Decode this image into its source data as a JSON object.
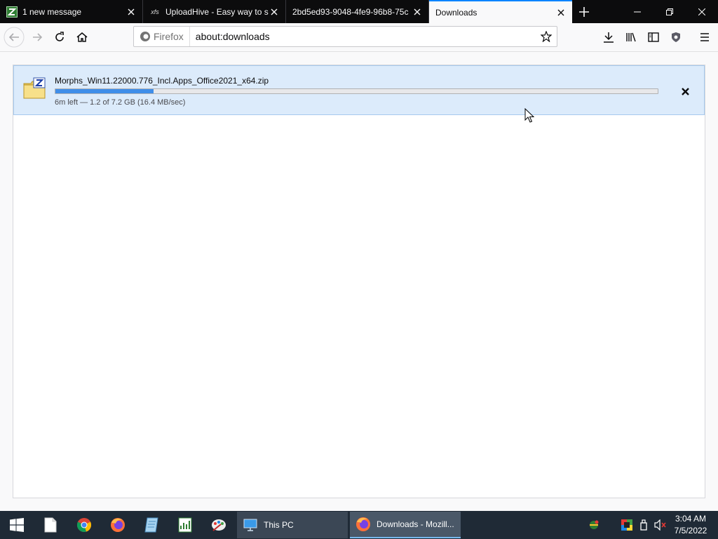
{
  "tabs": [
    {
      "title": "1 new message",
      "favicon": "z-mail-icon"
    },
    {
      "title": "UploadHive - Easy way to s",
      "favicon": "xfs-icon"
    },
    {
      "title": "2bd5ed93-9048-4fe9-96b8-75c",
      "favicon": "none"
    },
    {
      "title": "Downloads",
      "favicon": "none"
    }
  ],
  "urlbar": {
    "identity_label": "Firefox",
    "url": "about:downloads"
  },
  "download": {
    "filename": "Morphs_Win11.22000.776_Incl.Apps_Office2021_x64.zip",
    "status": "6m left — 1.2 of 7.2 GB (16.4 MB/sec)",
    "progress_fraction": 0.163
  },
  "taskbar": {
    "apps": [
      {
        "label": "This PC",
        "icon": "computer-icon"
      },
      {
        "label": "Downloads - Mozill...",
        "icon": "firefox-icon"
      }
    ],
    "time": "3:04 AM",
    "date": "7/5/2022"
  },
  "colors": {
    "tabstrip": "#0c0c0d",
    "accent": "#0a84ff",
    "download_bg": "#dcebfb",
    "progress_fill": "#3f8ee9",
    "taskbar": "#1f2a36"
  }
}
